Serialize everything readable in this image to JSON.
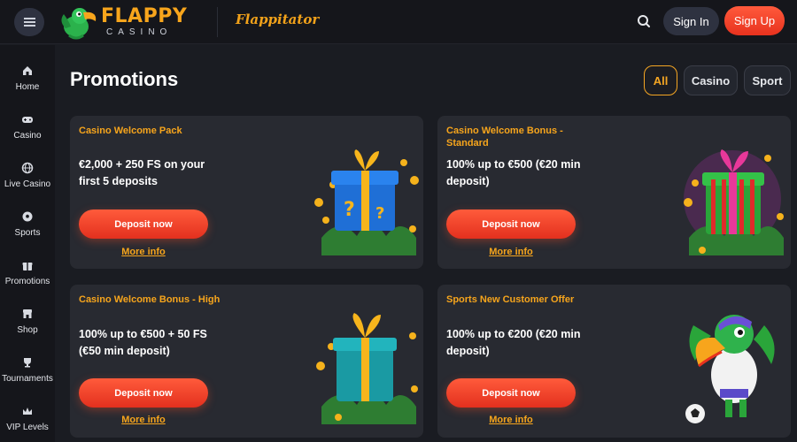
{
  "header": {
    "logo_main": "FLAPPY",
    "logo_sub": "CASINO",
    "partner": "Flappitator",
    "sign_in": "Sign In",
    "sign_up": "Sign Up",
    "menu_icon": "hamburger-icon",
    "search_icon": "search-icon"
  },
  "sidebar": {
    "items": [
      {
        "label": "Home",
        "icon": "home-icon"
      },
      {
        "label": "Casino",
        "icon": "gamepad-icon"
      },
      {
        "label": "Live Casino",
        "icon": "globe-icon"
      },
      {
        "label": "Sports",
        "icon": "ball-icon"
      },
      {
        "label": "Promotions",
        "icon": "gift-icon"
      },
      {
        "label": "Shop",
        "icon": "shop-icon"
      },
      {
        "label": "Tournaments",
        "icon": "trophy-icon"
      },
      {
        "label": "VIP Levels",
        "icon": "crown-icon"
      }
    ]
  },
  "main": {
    "title": "Promotions",
    "filters": [
      {
        "label": "All",
        "active": true
      },
      {
        "label": "Casino",
        "active": false
      },
      {
        "label": "Sport",
        "active": false
      }
    ],
    "promotions": [
      {
        "title": "Casino Welcome Pack",
        "description": "€2,000 + 250 FS on your first 5 deposits",
        "button": "Deposit now",
        "link": "More info",
        "art": "blue-gift-icon"
      },
      {
        "title": "Casino Welcome Bonus - Standard",
        "description": "100% up to €500 (€20 min deposit)",
        "button": "Deposit now",
        "link": "More info",
        "art": "green-gift-icon"
      },
      {
        "title": "Casino Welcome Bonus - High",
        "description": "100% up to €500 + 50 FS (€50 min deposit)",
        "button": "Deposit now",
        "link": "More info",
        "art": "teal-gift-icon"
      },
      {
        "title": "Sports New Customer Offer",
        "description": "100% up to €200 (€20 min deposit)",
        "button": "Deposit now",
        "link": "More info",
        "art": "toucan-mascot-icon"
      }
    ]
  },
  "colors": {
    "accent": "#f7a51c",
    "cta": "#e8321e",
    "background": "#1a1c22",
    "card": "#282a31"
  }
}
